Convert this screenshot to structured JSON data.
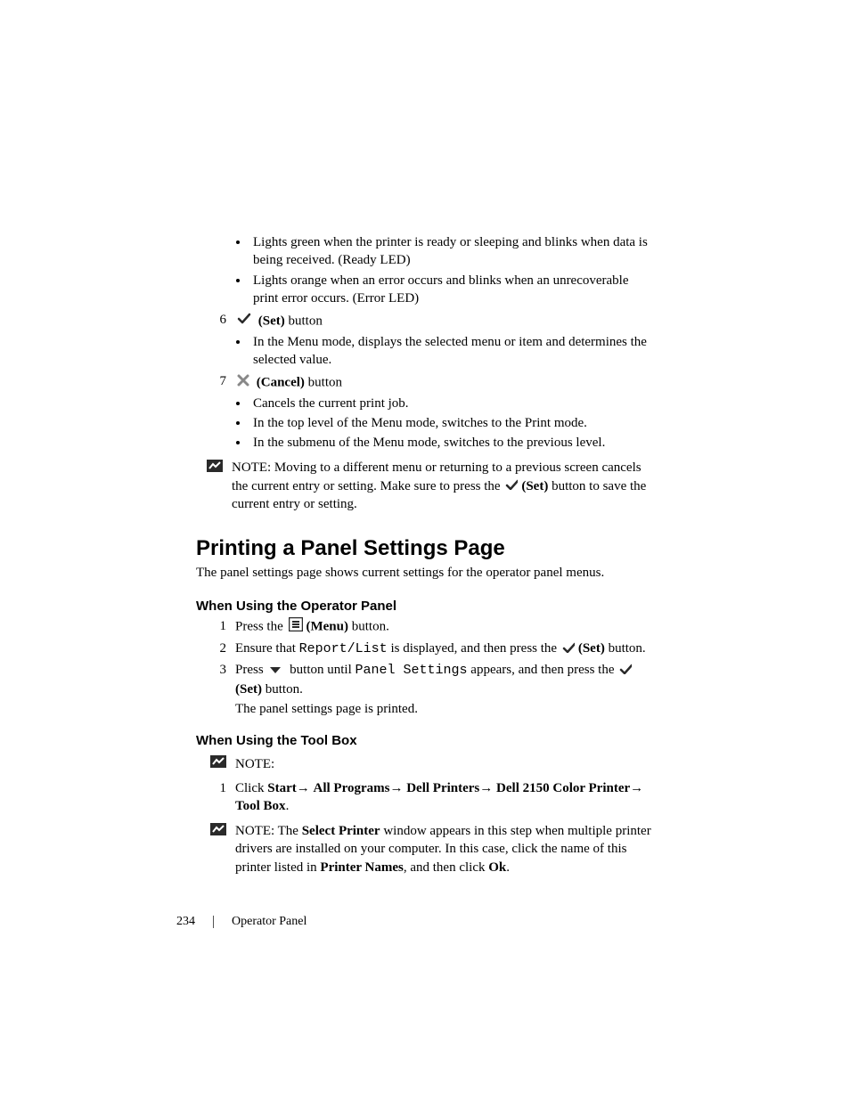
{
  "led": {
    "green": "Lights green when the printer is ready or sleeping and blinks when data is being received. (Ready LED)",
    "orange": "Lights orange when an error occurs and blinks when an unrecoverable print error occurs. (Error LED)"
  },
  "item6": {
    "num": "6",
    "label_bold": "(Set)",
    "label_rest": " button",
    "sub1": "In the Menu mode, displays the selected menu or item and determines the selected value."
  },
  "item7": {
    "num": "7",
    "label_bold": "(Cancel)",
    "label_rest": " button",
    "sub1": "Cancels the current print job.",
    "sub2": "In the top level of the Menu mode, switches to the Print mode.",
    "sub3": "In the submenu of the Menu mode, switches to the previous level."
  },
  "note1": {
    "prefix": "NOTE: ",
    "part1": "Moving to a different menu or returning to a previous screen cancels the current entry or setting. Make sure to press the ",
    "set_bold": "(Set)",
    "part2": " button to save the current entry or setting."
  },
  "section": {
    "title": "Printing a Panel Settings Page",
    "intro": "The panel settings page shows current settings for the operator panel menus."
  },
  "sub_a": {
    "title": "When Using the Operator Panel",
    "s1": {
      "n": "1",
      "pre": "Press the ",
      "menu_bold": "(Menu)",
      "post": " button."
    },
    "s2": {
      "n": "2",
      "pre": "Ensure that ",
      "code": "Report/List",
      "mid": " is displayed, and then press the ",
      "set_bold": "(Set)",
      "post": " button."
    },
    "s3": {
      "n": "3",
      "pre": "Press ",
      "mid1": " button until ",
      "code": "Panel Settings",
      "mid2": " appears, and then press the ",
      "set_bold": "(Set)",
      "post": " button."
    },
    "result": "The panel settings page is printed."
  },
  "sub_b": {
    "title": "When Using the Tool Box",
    "note_label": "NOTE:",
    "s1": {
      "n": "1",
      "pre": "Click ",
      "p1": "Start",
      "arrow": "→ ",
      "p2": "All Programs",
      "p3": "Dell Printers",
      "p4": "Dell 2150 Color Printer",
      "p5": "Tool Box",
      "end": "."
    },
    "note2": {
      "prefix": "NOTE: ",
      "part1": "The ",
      "bold1": "Select Printer",
      "part2": " window appears in this step when multiple printer drivers are installed on your computer. In this case, click the name of this printer listed in ",
      "bold2": "Printer Names",
      "part3": ", and then click ",
      "bold3": "Ok",
      "part4": "."
    }
  },
  "footer": {
    "page": "234",
    "label": "Operator Panel"
  }
}
